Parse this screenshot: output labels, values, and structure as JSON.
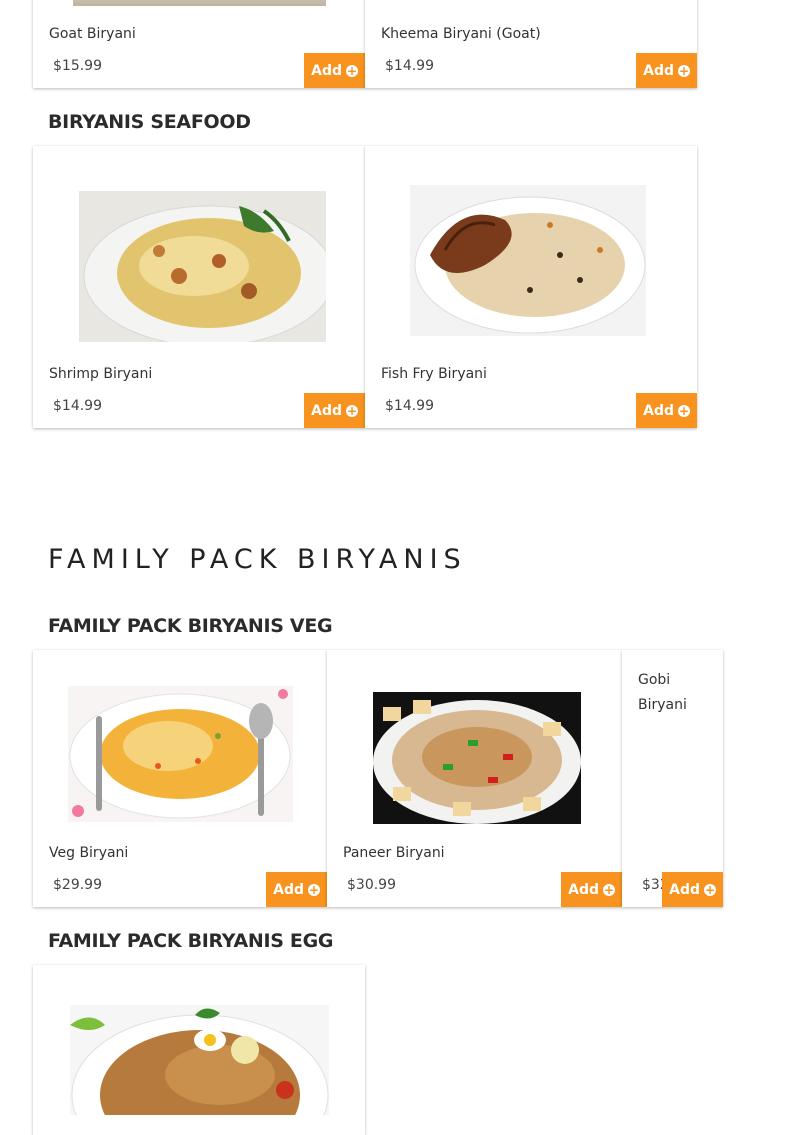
{
  "sections": {
    "biryanis_seafood": "BIRYANIS SEAFOOD",
    "family_pack": "FAMILY PACK BIRYANIS",
    "family_veg": "FAMILY PACK BIRYANIS VEG",
    "family_egg": "FAMILY PACK BIRYANIS EGG"
  },
  "add_label": "Add",
  "items": {
    "goat": {
      "name": "Goat Biryani",
      "price": "$15.99"
    },
    "kheema": {
      "name": "Kheema Biryani (Goat)",
      "price": "$14.99"
    },
    "shrimp": {
      "name": "Shrimp Biryani",
      "price": "$14.99"
    },
    "fishfry": {
      "name": "Fish Fry Biryani",
      "price": "$14.99"
    },
    "veg": {
      "name": "Veg Biryani",
      "price": "$29.99"
    },
    "paneer": {
      "name": "Paneer Biryani",
      "price": "$30.99"
    },
    "gobi": {
      "name": "Gobi Biryani",
      "price": "$32.99"
    }
  },
  "colors": {
    "accent": "#f7931e"
  }
}
